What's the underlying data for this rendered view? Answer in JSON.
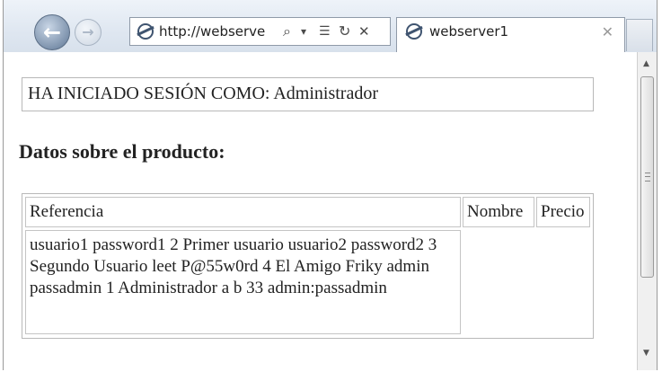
{
  "browser": {
    "address_url": "http://webserve",
    "search_glyph": "⌕",
    "dropdown_glyph": "▾",
    "compat_glyph": "☰",
    "refresh_glyph": "↻",
    "stop_glyph": "✕",
    "tab_title": "webserver1",
    "tab_close_glyph": "✕",
    "back_glyph": "←",
    "forward_glyph": "→",
    "icons": {
      "back": "back-arrow-icon",
      "forward": "forward-arrow-icon",
      "page": "ie-page-icon"
    }
  },
  "page": {
    "session_text": "HA INICIADO SESIÓN COMO: Administrador",
    "heading": "Datos sobre el producto:",
    "table": {
      "headers": [
        "Referencia",
        "Nombre",
        "Precio"
      ],
      "data_text": "usuario1 password1 2 Primer usuario usuario2 password2 3 Segundo Usuario leet P@55w0rd 4 El Amigo Friky admin passadmin 1 Administrador a b 33 admin:passadmin"
    }
  },
  "scrollbar": {
    "up_glyph": "▲",
    "down_glyph": "▼"
  },
  "colors": {
    "chrome_bg": "#dfe7f1",
    "back_button": "#7e93ad",
    "border": "#b8b8b8"
  }
}
